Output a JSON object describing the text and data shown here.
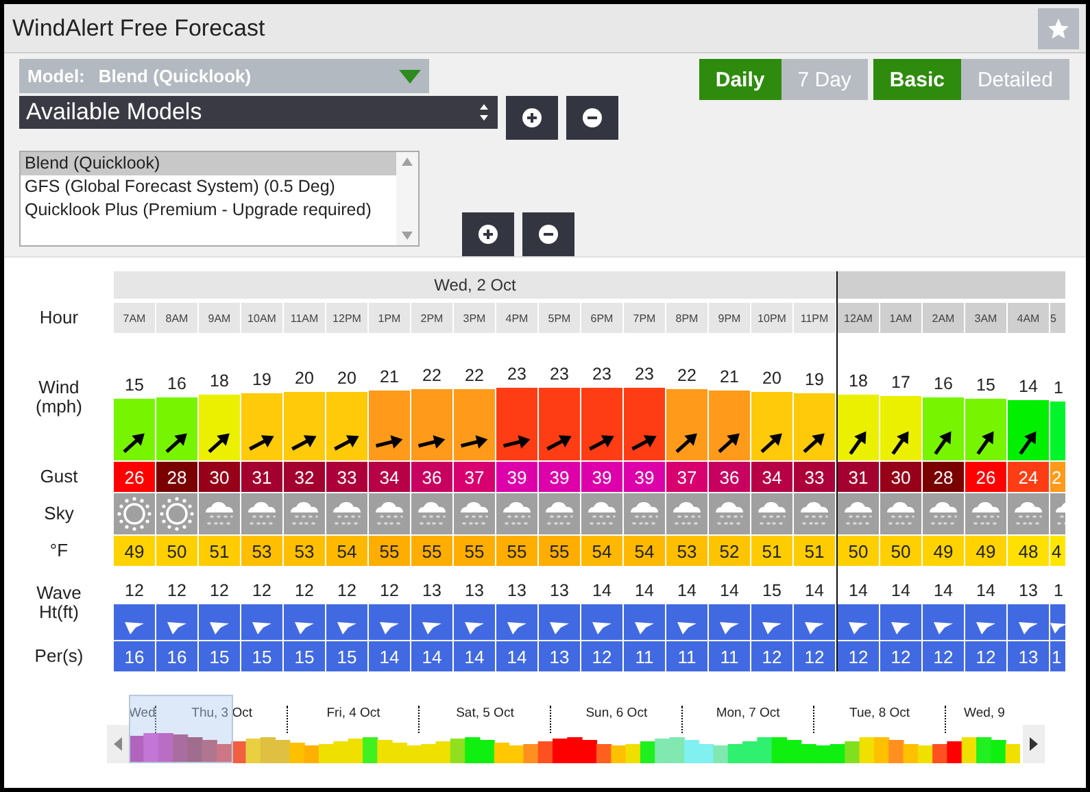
{
  "window": {
    "title": "WindAlert Free Forecast"
  },
  "model_bar": {
    "label": "Model:",
    "value": "Blend (Quicklook)"
  },
  "models_select": {
    "value": "Available Models"
  },
  "models_list": [
    {
      "label": "Blend (Quicklook)",
      "selected": true
    },
    {
      "label": "GFS (Global Forecast System) (0.5 Deg)",
      "selected": false
    },
    {
      "label": "Quicklook Plus (Premium - Upgrade required)",
      "selected": false
    }
  ],
  "range_toggle": [
    {
      "label": "Daily",
      "selected": true
    },
    {
      "label": "7 Day",
      "selected": false
    }
  ],
  "detail_toggle": [
    {
      "label": "Basic",
      "selected": true
    },
    {
      "label": "Detailed",
      "selected": false
    }
  ],
  "row_labels": {
    "hour": "Hour",
    "wind": "Wind\n(mph)",
    "gust": "Gust",
    "sky": "Sky",
    "temp": "°F",
    "wave": "Wave\nHt(ft)",
    "period": "Per(s)"
  },
  "days": [
    {
      "label": "Wed, 2 Oct",
      "columns": [
        {
          "hour": "7AM",
          "wind": {
            "value": "15",
            "color": "#77f500",
            "level": 0.6
          },
          "arrow": {
            "kind": "ne"
          },
          "gust": {
            "value": "26",
            "color": "#ff0000"
          },
          "sky": {
            "kind": "sun"
          },
          "temp": {
            "value": "49",
            "color": "#ffd200"
          },
          "wave": "12",
          "period": "16"
        },
        {
          "hour": "8AM",
          "wind": {
            "value": "16",
            "color": "#77f500",
            "level": 0.61
          },
          "arrow": {
            "kind": "ne"
          },
          "gust": {
            "value": "28",
            "color": "#7a0000"
          },
          "sky": {
            "kind": "sun"
          },
          "temp": {
            "value": "50",
            "color": "#ffcf00"
          },
          "wave": "12",
          "period": "16"
        },
        {
          "hour": "9AM",
          "wind": {
            "value": "18",
            "color": "#eaf000",
            "level": 0.64
          },
          "arrow": {
            "kind": "ne"
          },
          "gust": {
            "value": "30",
            "color": "#960018"
          },
          "sky": {
            "kind": "snow"
          },
          "temp": {
            "value": "51",
            "color": "#ffcc00"
          },
          "wave": "12",
          "period": "15"
        },
        {
          "hour": "10AM",
          "wind": {
            "value": "19",
            "color": "#ffca0a",
            "level": 0.65
          },
          "arrow": {
            "kind": "ene"
          },
          "gust": {
            "value": "31",
            "color": "#a3002f"
          },
          "sky": {
            "kind": "snow"
          },
          "temp": {
            "value": "53",
            "color": "#ffbe00"
          },
          "wave": "12",
          "period": "15"
        },
        {
          "hour": "11AM",
          "wind": {
            "value": "20",
            "color": "#ffca0a",
            "level": 0.67
          },
          "arrow": {
            "kind": "ene"
          },
          "gust": {
            "value": "32",
            "color": "#a3002f"
          },
          "sky": {
            "kind": "snow"
          },
          "temp": {
            "value": "53",
            "color": "#ffbe00"
          },
          "wave": "12",
          "period": "15"
        },
        {
          "hour": "12PM",
          "wind": {
            "value": "20",
            "color": "#ffca0a",
            "level": 0.67
          },
          "arrow": {
            "kind": "ene"
          },
          "gust": {
            "value": "33",
            "color": "#ad003a"
          },
          "sky": {
            "kind": "snow"
          },
          "temp": {
            "value": "54",
            "color": "#ffb800"
          },
          "wave": "12",
          "period": "15"
        },
        {
          "hour": "1PM",
          "wind": {
            "value": "21",
            "color": "#ff9a1a",
            "level": 0.68
          },
          "arrow": {
            "kind": "e"
          },
          "gust": {
            "value": "34",
            "color": "#b80046"
          },
          "sky": {
            "kind": "snow"
          },
          "temp": {
            "value": "55",
            "color": "#ffad00"
          },
          "wave": "12",
          "period": "14"
        },
        {
          "hour": "2PM",
          "wind": {
            "value": "22",
            "color": "#ff9a1a",
            "level": 0.69
          },
          "arrow": {
            "kind": "e"
          },
          "gust": {
            "value": "36",
            "color": "#c80060"
          },
          "sky": {
            "kind": "snow"
          },
          "temp": {
            "value": "55",
            "color": "#ffad00"
          },
          "wave": "13",
          "period": "14"
        },
        {
          "hour": "3PM",
          "wind": {
            "value": "22",
            "color": "#ff9a1a",
            "level": 0.69
          },
          "arrow": {
            "kind": "e"
          },
          "gust": {
            "value": "37",
            "color": "#d8006e"
          },
          "sky": {
            "kind": "snow"
          },
          "temp": {
            "value": "55",
            "color": "#ffad00"
          },
          "wave": "13",
          "period": "14"
        },
        {
          "hour": "4PM",
          "wind": {
            "value": "23",
            "color": "#ff3d14",
            "level": 0.71
          },
          "arrow": {
            "kind": "e"
          },
          "gust": {
            "value": "39",
            "color": "#dd00aa"
          },
          "sky": {
            "kind": "snow"
          },
          "temp": {
            "value": "55",
            "color": "#ffad00"
          },
          "wave": "13",
          "period": "14"
        },
        {
          "hour": "5PM",
          "wind": {
            "value": "23",
            "color": "#ff3d14",
            "level": 0.71
          },
          "arrow": {
            "kind": "ene"
          },
          "gust": {
            "value": "39",
            "color": "#dd00aa"
          },
          "sky": {
            "kind": "snow"
          },
          "temp": {
            "value": "55",
            "color": "#ffad00"
          },
          "wave": "13",
          "period": "13"
        },
        {
          "hour": "6PM",
          "wind": {
            "value": "23",
            "color": "#ff3d14",
            "level": 0.71
          },
          "arrow": {
            "kind": "ene"
          },
          "gust": {
            "value": "39",
            "color": "#dd00aa"
          },
          "sky": {
            "kind": "snow"
          },
          "temp": {
            "value": "54",
            "color": "#ffb800"
          },
          "wave": "14",
          "period": "12"
        },
        {
          "hour": "7PM",
          "wind": {
            "value": "23",
            "color": "#ff3d14",
            "level": 0.71
          },
          "arrow": {
            "kind": "ene"
          },
          "gust": {
            "value": "39",
            "color": "#dd00aa"
          },
          "sky": {
            "kind": "snow"
          },
          "temp": {
            "value": "54",
            "color": "#ffb800"
          },
          "wave": "14",
          "period": "11"
        },
        {
          "hour": "8PM",
          "wind": {
            "value": "22",
            "color": "#ff9a1a",
            "level": 0.69
          },
          "arrow": {
            "kind": "ne"
          },
          "gust": {
            "value": "37",
            "color": "#d8006e"
          },
          "sky": {
            "kind": "snow"
          },
          "temp": {
            "value": "53",
            "color": "#ffbe00"
          },
          "wave": "14",
          "period": "11"
        },
        {
          "hour": "9PM",
          "wind": {
            "value": "21",
            "color": "#ff9a1a",
            "level": 0.68
          },
          "arrow": {
            "kind": "ne"
          },
          "gust": {
            "value": "36",
            "color": "#c80060"
          },
          "sky": {
            "kind": "snow"
          },
          "temp": {
            "value": "52",
            "color": "#ffc400"
          },
          "wave": "14",
          "period": "11"
        },
        {
          "hour": "10PM",
          "wind": {
            "value": "20",
            "color": "#ffca0a",
            "level": 0.67
          },
          "arrow": {
            "kind": "ne"
          },
          "gust": {
            "value": "34",
            "color": "#b80046"
          },
          "sky": {
            "kind": "snow"
          },
          "temp": {
            "value": "51",
            "color": "#ffcc00"
          },
          "wave": "15",
          "period": "12"
        },
        {
          "hour": "11PM",
          "wind": {
            "value": "19",
            "color": "#ffca0a",
            "level": 0.65
          },
          "arrow": {
            "kind": "ne"
          },
          "gust": {
            "value": "33",
            "color": "#ad003a"
          },
          "sky": {
            "kind": "snow"
          },
          "temp": {
            "value": "51",
            "color": "#ffcc00"
          },
          "wave": "14",
          "period": "12"
        }
      ]
    },
    {
      "columns": [
        {
          "hour": "12AM",
          "wind": {
            "value": "18",
            "color": "#eaf000",
            "level": 0.64
          },
          "arrow": {
            "kind": "nne"
          },
          "gust": {
            "value": "31",
            "color": "#a3002f"
          },
          "sky": {
            "kind": "snow"
          },
          "temp": {
            "value": "50",
            "color": "#ffcf00"
          },
          "wave": "14",
          "period": "12"
        },
        {
          "hour": "1AM",
          "wind": {
            "value": "17",
            "color": "#eaf000",
            "level": 0.63
          },
          "arrow": {
            "kind": "nne"
          },
          "gust": {
            "value": "30",
            "color": "#960018"
          },
          "sky": {
            "kind": "snow"
          },
          "temp": {
            "value": "50",
            "color": "#ffcf00"
          },
          "wave": "14",
          "period": "12"
        },
        {
          "hour": "2AM",
          "wind": {
            "value": "16",
            "color": "#77f500",
            "level": 0.61
          },
          "arrow": {
            "kind": "nne"
          },
          "gust": {
            "value": "28",
            "color": "#7a0000"
          },
          "sky": {
            "kind": "snow"
          },
          "temp": {
            "value": "49",
            "color": "#ffd200"
          },
          "wave": "14",
          "period": "12"
        },
        {
          "hour": "3AM",
          "wind": {
            "value": "15",
            "color": "#77f500",
            "level": 0.6
          },
          "arrow": {
            "kind": "nne"
          },
          "gust": {
            "value": "26",
            "color": "#ff0000"
          },
          "sky": {
            "kind": "snow"
          },
          "temp": {
            "value": "49",
            "color": "#ffd200"
          },
          "wave": "14",
          "period": "12"
        },
        {
          "hour": "4AM",
          "wind": {
            "value": "14",
            "color": "#00f000",
            "level": 0.59
          },
          "arrow": {
            "kind": "nne"
          },
          "gust": {
            "value": "24",
            "color": "#ff3d14"
          },
          "sky": {
            "kind": "snow"
          },
          "temp": {
            "value": "48",
            "color": "#ffe000"
          },
          "wave": "13",
          "period": "13"
        },
        {
          "hour": "5",
          "wind": {
            "value": "1",
            "color": "#00f52a",
            "level": 0.57
          },
          "gust": {
            "value": "2",
            "color": "#ff9a1a"
          },
          "sky": {
            "kind": "snow"
          },
          "temp": {
            "value": "4",
            "color": "#ffe600"
          },
          "wave": "1",
          "period": "1"
        }
      ]
    }
  ],
  "timeline": {
    "days": [
      "Wed",
      "Thu, 3 Oct",
      "Fri, 4 Oct",
      "Sat, 5 Oct",
      "Sun, 6 Oct",
      "Mon, 7 Oct",
      "Tue, 8 Oct",
      "Wed, 9"
    ]
  }
}
